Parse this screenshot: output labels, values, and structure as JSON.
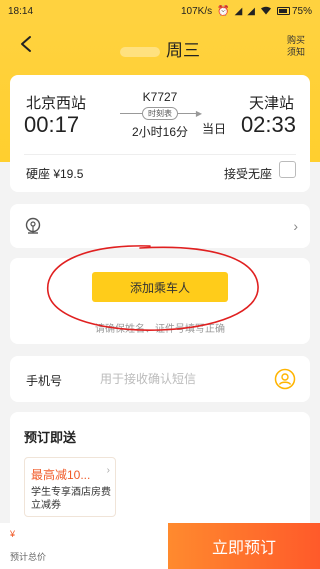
{
  "status_bar": {
    "time": "18:14",
    "network_speed": "107K/s",
    "battery": "75%",
    "icons": [
      "alarm-icon",
      "signal-icon",
      "signal-icon",
      "wifi-icon",
      "battery-icon"
    ]
  },
  "header": {
    "title": "周三",
    "buy_notice": "购买须知"
  },
  "train": {
    "from_station": "北京西站",
    "from_time": "00:17",
    "to_station": "天津站",
    "to_time": "02:33",
    "arrive_tag": "当日",
    "train_no": "K7727",
    "timetable_label": "时刻表",
    "duration": "2小时16分",
    "seat_info": "硬座 ¥19.5",
    "accept_no_seat": "接受无座"
  },
  "passenger": {
    "add_button": "添加乘车人",
    "tip": "请确保姓名、证件号填写正确"
  },
  "phone": {
    "label": "手机号",
    "placeholder": "用于接收确认短信"
  },
  "booking": {
    "title": "预订即送",
    "coupon_title": "最高减10...",
    "coupon_desc": "学生专享酒店房费立减券"
  },
  "bottom": {
    "price_symbol": "¥",
    "total_label": "预计总价",
    "book_button": "立即预订"
  },
  "colors": {
    "header_yellow": "#ffd23f",
    "button_yellow": "#ffcc1a",
    "accent_orange": "#ff5a2a",
    "coupon_orange": "#f05a28",
    "annotation_red": "#e02020"
  }
}
